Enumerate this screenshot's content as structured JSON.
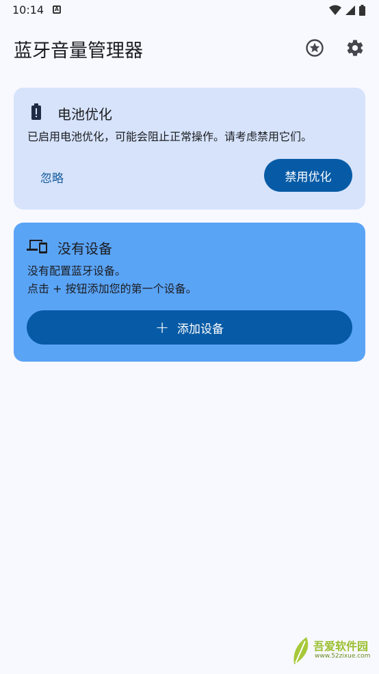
{
  "status_bar": {
    "time": "10:14",
    "notification_icon": "A"
  },
  "app_bar": {
    "title": "蓝牙音量管理器",
    "actions": [
      "star-badge-icon",
      "settings-gear-icon"
    ]
  },
  "battery_card": {
    "icon": "battery-alert-icon",
    "title": "电池优化",
    "message": "已启用电池优化，可能会阻止正常操作。请考虑禁用它们。",
    "ignore_label": "忽略",
    "disable_label": "禁用优化"
  },
  "devices_card": {
    "icon": "devices-icon",
    "title": "没有设备",
    "line1": "没有配置蓝牙设备。",
    "line2": "点击 + 按钮添加您的第一个设备。",
    "add_icon": "+",
    "add_label": "添加设备"
  },
  "watermark": {
    "text": "吾爱软件园",
    "url": "www.52zixue.com"
  },
  "colors": {
    "background": "#f8f9ff",
    "battery_card": "#d6e3fb",
    "devices_card": "#5aa4f6",
    "primary_button": "#075ba6",
    "text_button": "#155b9a"
  }
}
